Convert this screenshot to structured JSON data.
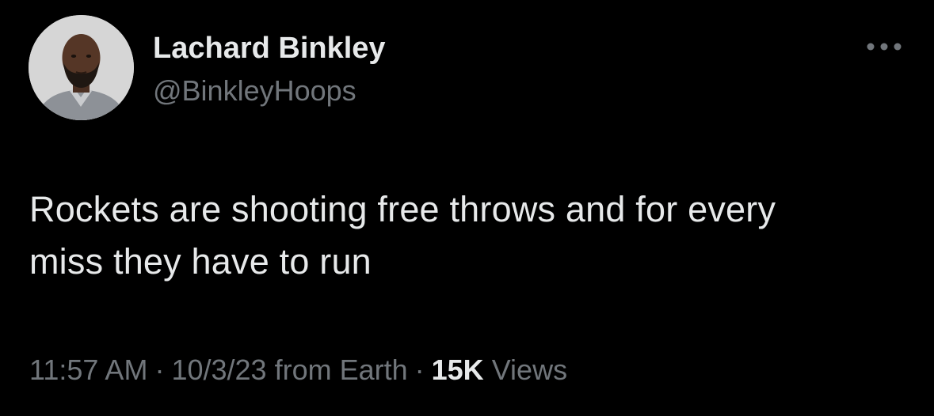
{
  "user": {
    "display_name": "Lachard Binkley",
    "handle": "@BinkleyHoops"
  },
  "tweet": {
    "text_line1": "Rockets are shooting free throws and for every",
    "text_line2": "miss they have to run"
  },
  "meta": {
    "time": "11:57 AM",
    "separator": "·",
    "date": "10/3/23",
    "source": "from Earth",
    "views_count": "15K",
    "views_label": "Views"
  },
  "icons": {
    "more": "more-horizontal-icon",
    "avatar": "profile-photo"
  },
  "colors": {
    "background": "#000000",
    "primary_text": "#e7e9ea",
    "secondary_text": "#71767b"
  }
}
